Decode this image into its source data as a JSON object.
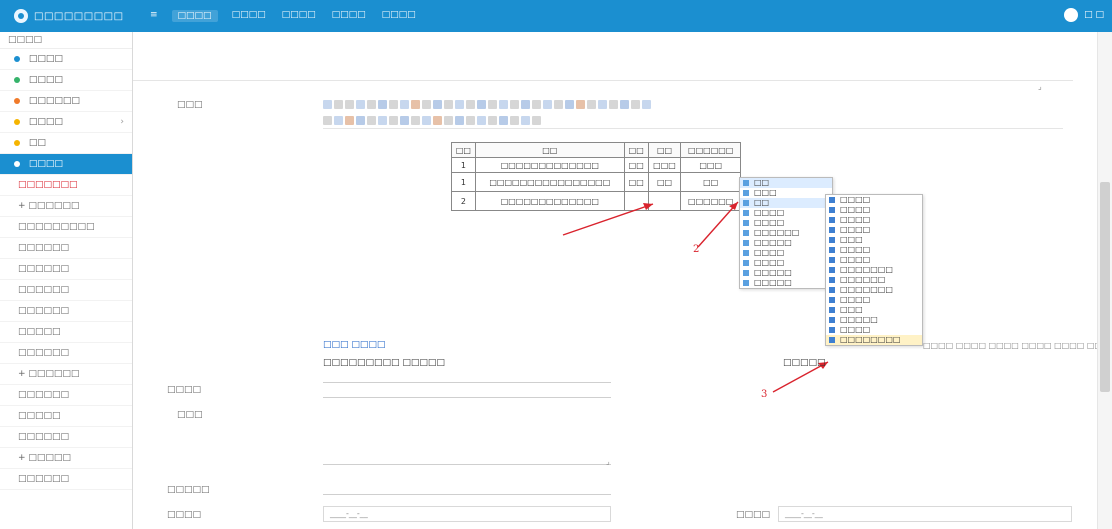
{
  "topbar": {
    "logo_text": "□□□□□□□□□",
    "nav": [
      "□□□□",
      "□□□□",
      "□□□□",
      "□□□□",
      "□□□□"
    ],
    "user": "□ □"
  },
  "sidebar": {
    "heading": "□□□□",
    "items": [
      {
        "label": "□□□□",
        "color": "#1b8fd0"
      },
      {
        "label": "□□□□",
        "color": "#36b36b"
      },
      {
        "label": "□□□□□□",
        "color": "#f07a2a"
      },
      {
        "label": "□□□□",
        "color": "#f5b400",
        "caret": "›"
      },
      {
        "label": "□□",
        "color": "#f5b400"
      },
      {
        "label": "□□□□",
        "color": "#ffffff"
      }
    ],
    "subitems": [
      "□□□□□□□",
      "+ □□□□□□",
      "□□□□□□□□□",
      "□□□□□□",
      "□□□□□□",
      "□□□□□□",
      "□□□□□□",
      "□□□□□",
      "□□□□□□",
      "+ □□□□□□",
      "□□□□□□",
      "□□□□□",
      "□□□□□□",
      "+ □□□□□",
      "□□□□□□"
    ]
  },
  "main": {
    "content_label": "□□□",
    "table": {
      "headers": [
        "□□",
        "□□",
        "□□",
        "□□",
        "□□□□□□"
      ],
      "row0": [
        "1",
        "□□□□□□□□□□□□□",
        "□□",
        "□□□",
        "□□□"
      ],
      "rows": [
        [
          "1",
          "□□□□□□□□□□□□□□□□",
          "□□",
          "□□",
          "□□"
        ],
        [
          "2",
          "□□□□□□□□□□□□□",
          "",
          "",
          "□□□□□□"
        ]
      ]
    },
    "context_menu": [
      {
        "label": "□□",
        "sel": true
      },
      {
        "label": "□□□",
        "sel": false
      },
      {
        "label": "□□",
        "sel": false,
        "arrow": "›"
      },
      {
        "label": "□□□□",
        "sel": false
      },
      {
        "label": "□□□□",
        "sel": false
      },
      {
        "label": "□□□□□□",
        "sel": false
      },
      {
        "label": "□□□□□",
        "sel": false
      },
      {
        "label": "□□□□",
        "sel": false
      },
      {
        "label": "□□□□",
        "sel": false
      },
      {
        "label": "□□□□□",
        "sel": false
      },
      {
        "label": "□□□□□",
        "sel": false
      }
    ],
    "submenu": [
      "□□□□",
      "□□□□",
      "□□□□",
      "□□□□",
      "□□□",
      "□□□□",
      "□□□□",
      "□□□□□□□",
      "□□□□□□",
      "□□□□□□□",
      "□□□□",
      "□□□",
      "□□□□□",
      "□□□□",
      "□□□□□□□□"
    ],
    "arrow_labels": {
      "a2": "2",
      "a3": "3"
    },
    "footer_link": "□□□ □□□□",
    "footer_line": "□□□□□□□□□ □□□□□",
    "right_line": "□□□□□",
    "right_links": "□□□□ □□□□ □□□□ □□□□ □□□□ □□",
    "field_labels": [
      "□□□□",
      "□□□",
      "□□□□□",
      "□□□□"
    ],
    "date_left": "____-__-__",
    "date_right_label": "□□□□",
    "date_right": "____-__-__"
  }
}
